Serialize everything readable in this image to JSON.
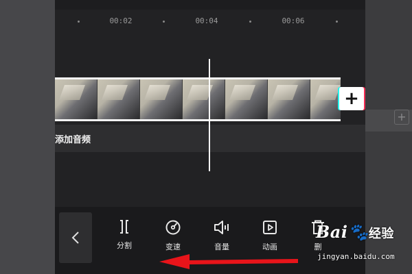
{
  "timeline": {
    "ticks": [
      "00:02",
      "00:04",
      "00:06"
    ]
  },
  "video_track": {
    "thumbnail_count": 7,
    "add_clip_label": "+"
  },
  "audio_track": {
    "label": "添加音频"
  },
  "toolbar": {
    "tools": [
      {
        "label": "分割",
        "icon": "split-icon"
      },
      {
        "label": "变速",
        "icon": "speed-icon"
      },
      {
        "label": "音量",
        "icon": "volume-icon"
      },
      {
        "label": "动画",
        "icon": "animation-icon"
      },
      {
        "label": "删",
        "icon": "delete-icon"
      }
    ]
  },
  "annotation": {
    "arrow_color": "#e8141a",
    "arrow_direction": "left"
  },
  "watermark": {
    "logo": "Bai",
    "logo_suffix": "经验",
    "url": "jingyan.baidu.com"
  },
  "colors": {
    "app_background": "#222224",
    "toolbar_background": "#1a1a1c",
    "playhead": "#ffffff"
  }
}
